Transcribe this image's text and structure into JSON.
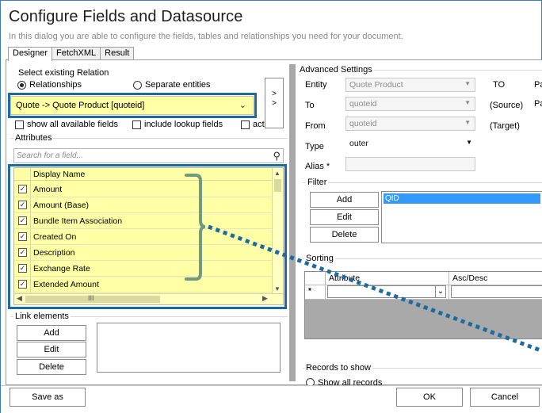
{
  "dialog": {
    "title": "Configure Fields and Datasource",
    "subtitle": "In this dialog you are able to configure the fields, tables and relationships you need for your document."
  },
  "tabs": [
    {
      "label": "Designer",
      "active": true
    },
    {
      "label": "FetchXML",
      "active": false
    },
    {
      "label": "Result",
      "active": false
    }
  ],
  "left": {
    "select_relation_label": "Select existing Relation",
    "radio_relationships": "Relationships",
    "radio_separate": "Separate entities",
    "selected_radio": "Relationships",
    "relation_value": "Quote -> Quote Product   [quoteid]",
    "arrow_button_top": ">",
    "arrow_button_bottom": ">",
    "checkbox_show_all": "show all available fields",
    "checkbox_lookup": "include lookup fields",
    "checkbox_third": "act",
    "attributes_label": "Attributes",
    "search_placeholder": "Search for a field...",
    "grid_header": "Display Name",
    "fields": [
      {
        "name": "Amount",
        "checked": true
      },
      {
        "name": "Amount (Base)",
        "checked": true
      },
      {
        "name": "Bundle Item Association",
        "checked": true
      },
      {
        "name": "Created On",
        "checked": true
      },
      {
        "name": "Description",
        "checked": true
      },
      {
        "name": "Exchange Rate",
        "checked": true
      },
      {
        "name": "Extended Amount",
        "checked": true
      }
    ],
    "hscroll_mid": "III",
    "link_elements_label": "Link elements",
    "link_add": "Add",
    "link_edit": "Edit",
    "link_delete": "Delete"
  },
  "right": {
    "advanced_label": "Advanced Settings",
    "entity_label": "Entity",
    "entity_value": "Quote Product",
    "to_header": "TO",
    "to_label": "To",
    "to_value": "quoteid",
    "to_note": "(Source)",
    "from_label": "From",
    "from_value": "quoteid",
    "from_note": "(Target)",
    "pa_1": "Pa",
    "pa_2": "Pa",
    "type_label": "Type",
    "type_value": "outer",
    "alias_label": "Alias *",
    "filter_label": "Filter",
    "filter_add": "Add",
    "filter_edit": "Edit",
    "filter_delete": "Delete",
    "filter_item": "QID",
    "sorting_label": "Sorting",
    "sort_col_attribute": "Attribute",
    "sort_col_ascdesc": "Asc/Desc",
    "sort_new_marker": "*",
    "records_label": "Records to show",
    "records_option": "Show all records"
  },
  "footer": {
    "save_as": "Save as",
    "ok": "OK",
    "cancel": "Cancel"
  },
  "colors": {
    "highlight_yellow": "#ffffa5",
    "annotation_blue": "#1b6aa2",
    "annotation_green": "#6f9a7d"
  }
}
